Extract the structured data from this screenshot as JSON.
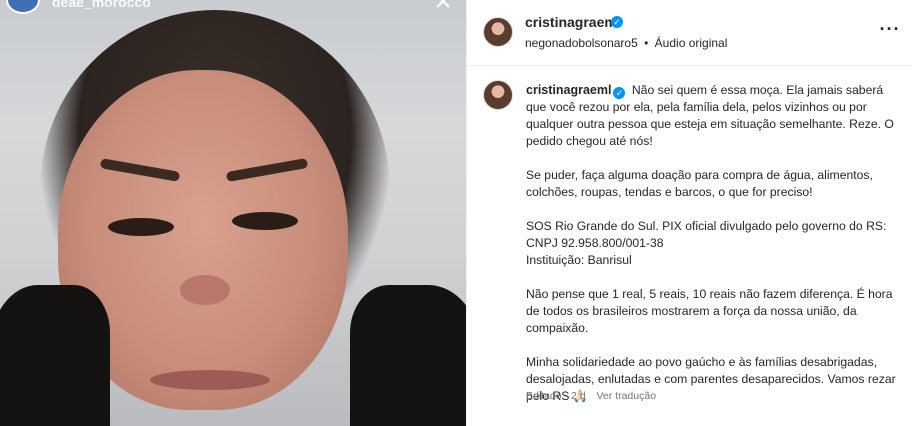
{
  "media": {
    "top_username": "deae_morocco"
  },
  "post": {
    "username": "cristinagraeml",
    "audio_username": "negonadobolsonaro5",
    "audio_label": "Áudio original",
    "separator": "•",
    "more_icon": "more-options-icon"
  },
  "caption": {
    "username": "cristinagraeml",
    "paragraphs": [
      "Não sei quem é essa moça. Ela jamais saberá que você rezou por ela, pela família dela, pelos vizinhos ou por qualquer outra pessoa que esteja em situação semelhante. Reze. O pedido chegou até nós!",
      "Se puder, faça alguma doação para compra de água, alimentos, colchões, roupas, tendas e barcos, o que for preciso!",
      "SOS Rio Grande do Sul. PIX oficial divulgado pelo governo do RS: CNPJ 92.958.800/001-38\nInstituição: Banrisul",
      "Não pense que 1 real, 5 reais, 10 reais não fazem diferença. É hora de todos os brasileiros mostrarem a força da nossa união, da compaixão.",
      "Minha solidariedade ao povo gaúcho e às famílias desabrigadas, desalojadas, enlutadas e com parentes desaparecidos. Vamos rezar pelo RS 🙏🏻"
    ],
    "edited_label": "Editado",
    "time": "2 d",
    "translate_label": "Ver tradução"
  },
  "colors": {
    "verified_blue": "#0095f6",
    "text": "#262626",
    "muted": "#737373",
    "border": "#efefef"
  }
}
